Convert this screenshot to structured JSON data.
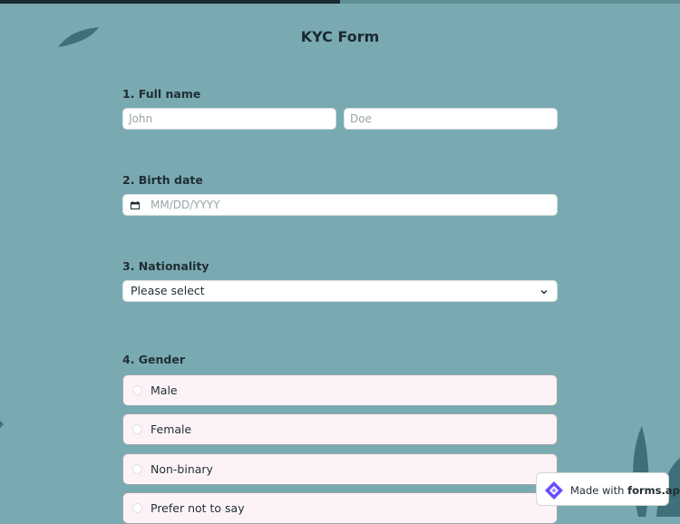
{
  "progress": {
    "fraction": 0.5,
    "fill_color": "#1b2a2f"
  },
  "form": {
    "title": "KYC Form"
  },
  "questions": {
    "full_name": {
      "label": "1. Full name",
      "first_placeholder": "John",
      "last_placeholder": "Doe"
    },
    "birth_date": {
      "label": "2. Birth date",
      "placeholder": "MM/DD/YYYY",
      "icon": "calendar-icon"
    },
    "nationality": {
      "label": "3. Nationality",
      "selected": "Please select",
      "icon": "chevron-down-icon"
    },
    "gender": {
      "label": "4. Gender",
      "options": [
        "Male",
        "Female",
        "Non-binary",
        "Prefer not to say"
      ]
    }
  },
  "badge": {
    "made_with": "Made with",
    "brand": "forms.app",
    "icon": "formsapp-logo-icon"
  },
  "colors": {
    "background": "#79aab1",
    "option_bg": "#fdf3f7",
    "leaf": "#3f6f78"
  }
}
